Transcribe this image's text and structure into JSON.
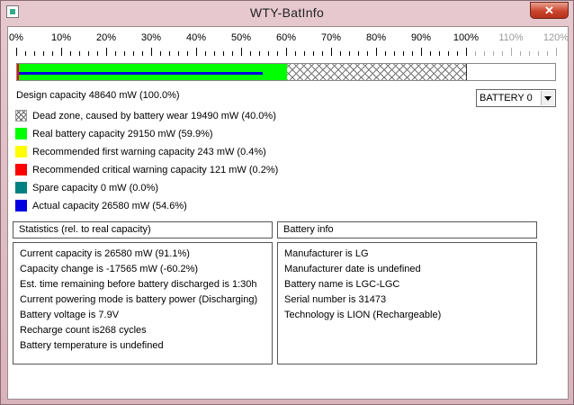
{
  "window": {
    "title": "WTY-BatInfo",
    "close_glyph": "✕"
  },
  "scale": {
    "labels": [
      "0%",
      "10%",
      "20%",
      "30%",
      "40%",
      "50%",
      "60%",
      "70%",
      "80%",
      "90%",
      "100%",
      "110%",
      "120%"
    ],
    "dim_from_index": 11
  },
  "bar": {
    "critical_pct": 0.2,
    "real_pct": 59.9,
    "dead_zone_pct": 40.0,
    "actual_pct": 54.6,
    "colors": {
      "real": "#00ff00",
      "critical": "#ff0000",
      "actual": "#0000e0"
    }
  },
  "design_capacity": "Design capacity 48640 mW (100.0%)",
  "legend": [
    {
      "swatch": "hatch",
      "color": "",
      "text": "Dead zone, caused by battery wear 19490 mW (40.0%)"
    },
    {
      "swatch": "solid",
      "color": "#00ff00",
      "text": "Real battery capacity 29150 mW (59.9%)"
    },
    {
      "swatch": "solid",
      "color": "#ffff00",
      "text": "Recommended first warning capacity 243 mW (0.4%)"
    },
    {
      "swatch": "solid",
      "color": "#ff0000",
      "text": "Recommended critical warning capacity 121 mW (0.2%)"
    },
    {
      "swatch": "solid",
      "color": "#008080",
      "text": "Spare capacity  0 mW (0.0%)"
    },
    {
      "swatch": "solid",
      "color": "#0000e0",
      "text": "Actual capacity 26580 mW (54.6%)"
    }
  ],
  "battery_select": {
    "value": "BATTERY 0"
  },
  "statistics": {
    "title": "Statistics (rel. to real capacity)",
    "lines": [
      "Current capacity is 26580 mW (91.1%)",
      "Capacity change is -17565 mW (-60.2%)",
      "Est. time remaining before battery discharged is 1:30h",
      "Current powering mode is battery power (Discharging)",
      "Battery voltage is 7.9V",
      "Recharge count is268 cycles",
      "Battery temperature is undefined"
    ]
  },
  "battery_info": {
    "title": "Battery info",
    "lines": [
      "Manufacturer is  LG",
      "Manufacturer date is undefined",
      "Battery name is LGC-LGC",
      "Serial number is 31473",
      "Technology is LION (Rechargeable)"
    ]
  }
}
